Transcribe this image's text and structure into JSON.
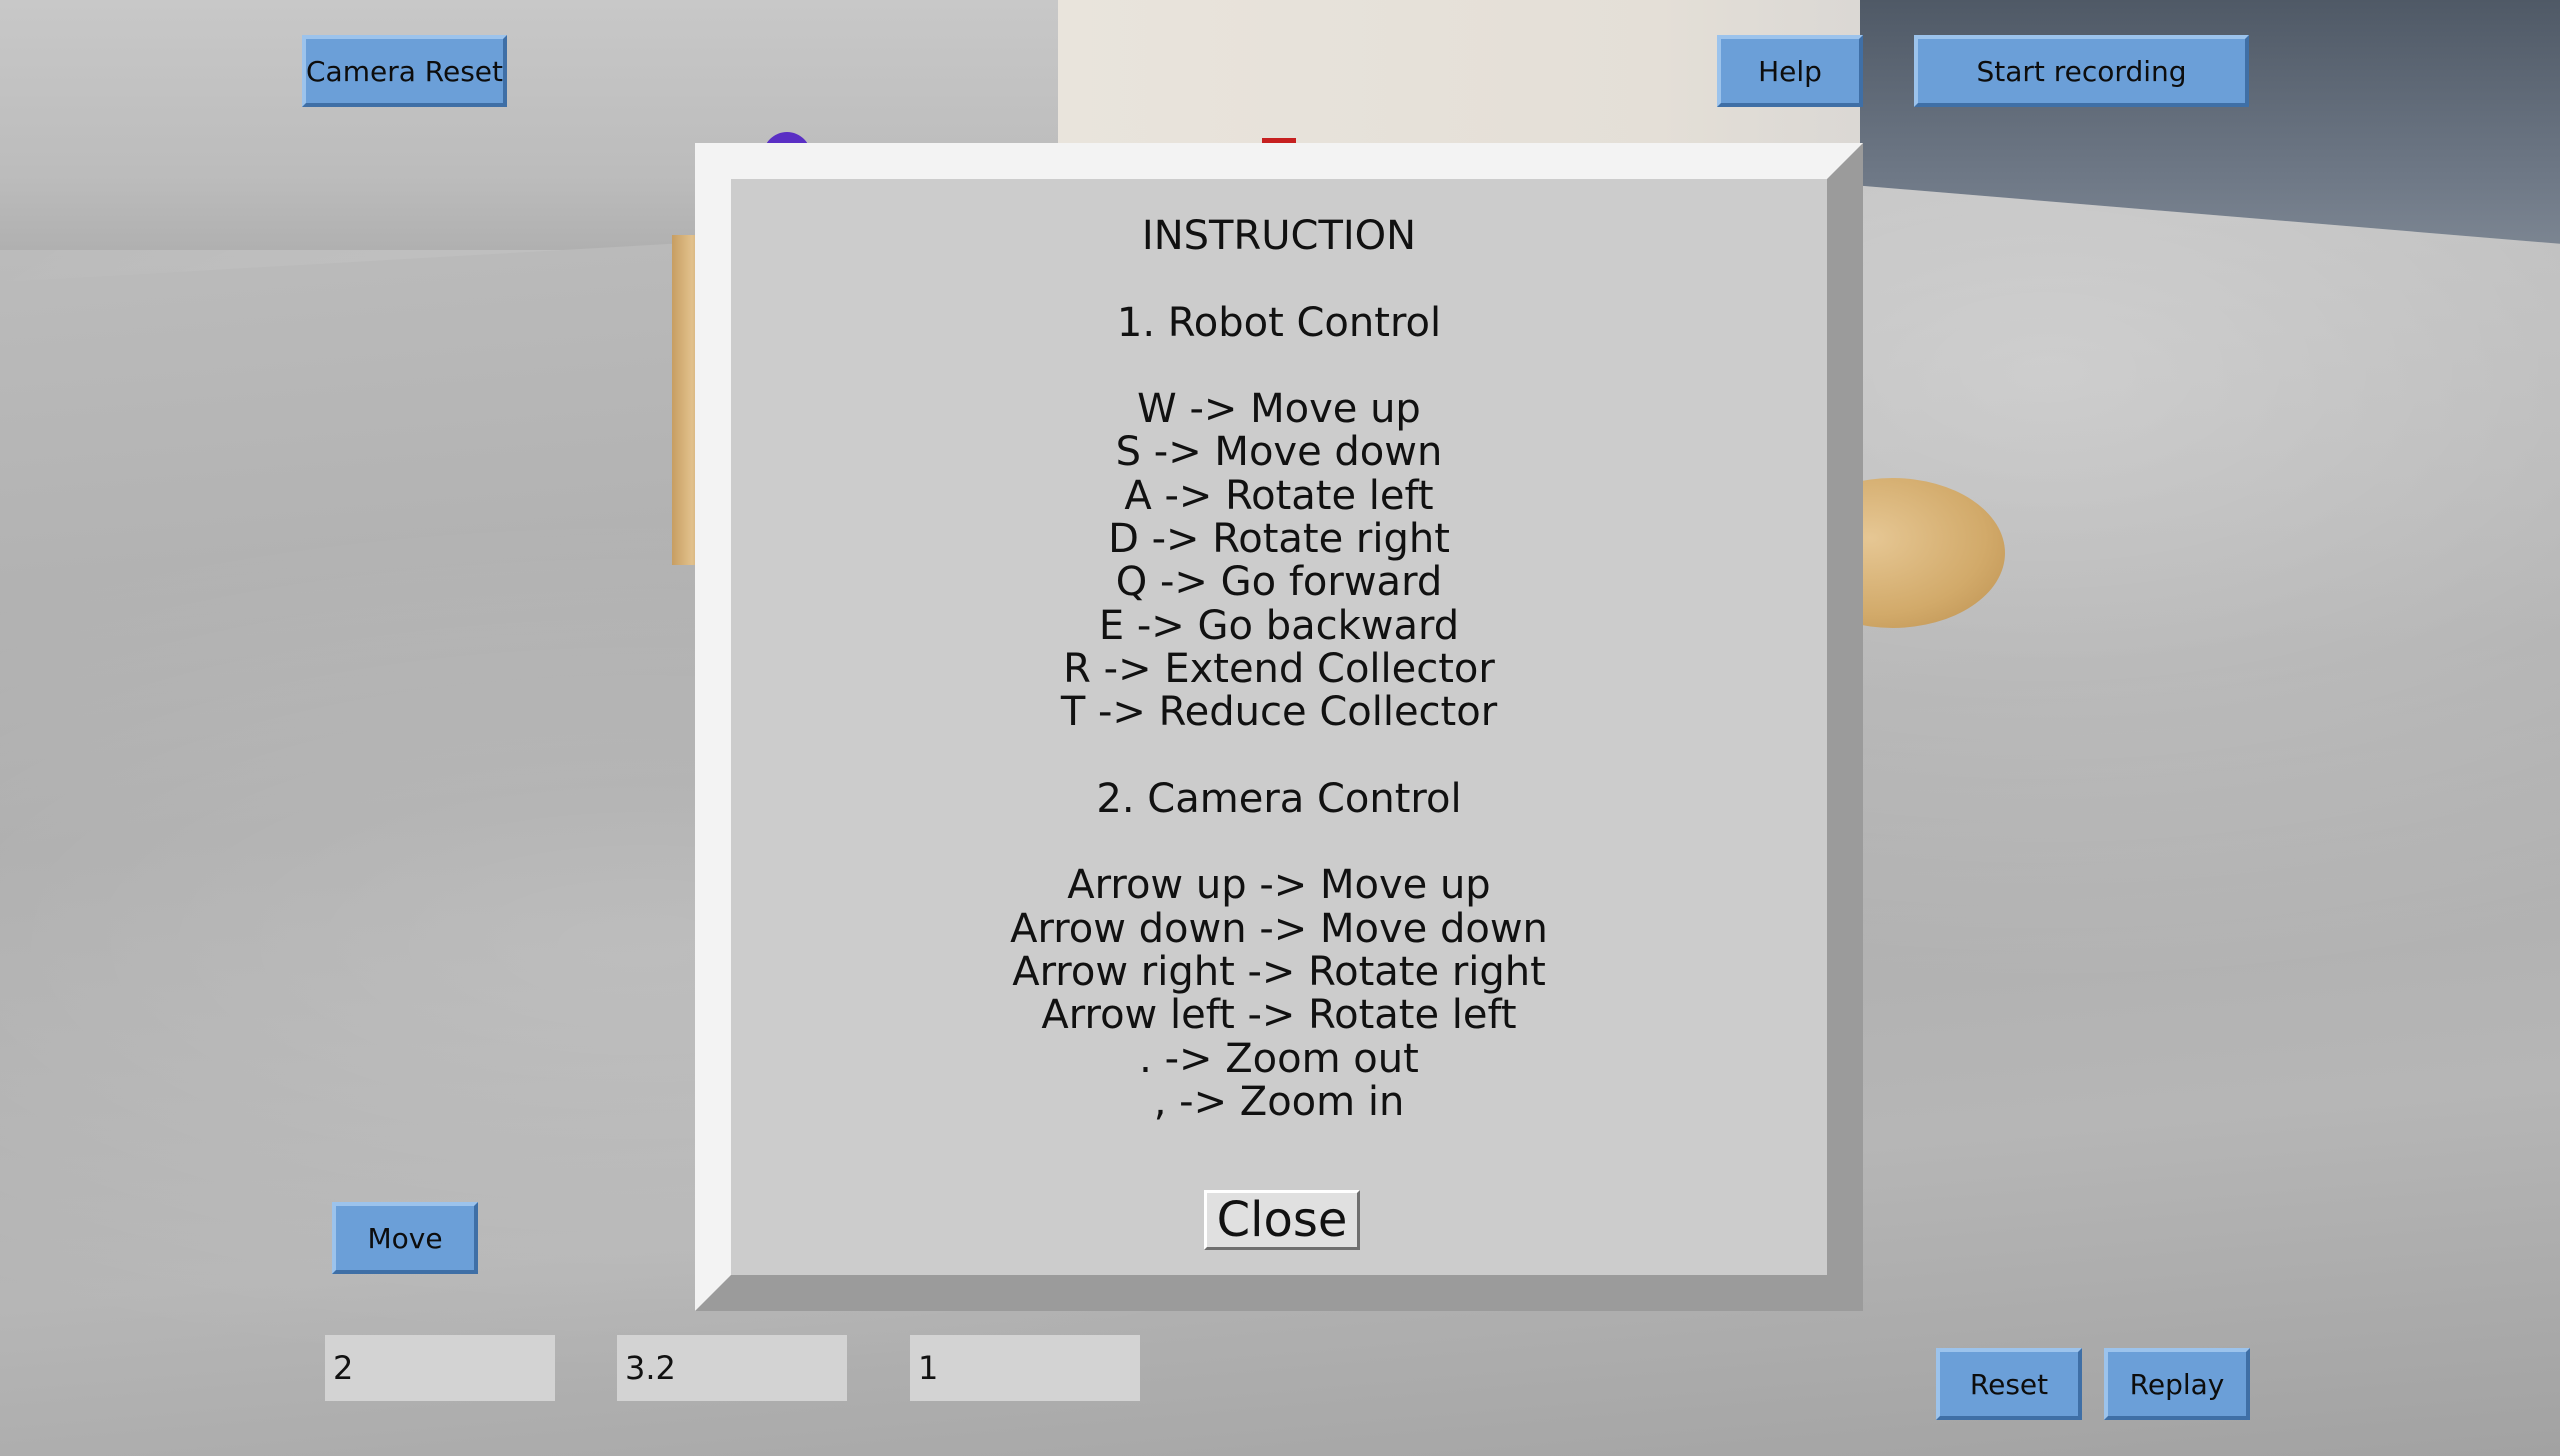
{
  "toolbar": {
    "camera_reset_label": "Camera Reset",
    "help_label": "Help",
    "start_recording_label": "Start recording"
  },
  "controls": {
    "move_label": "Move",
    "inputs": [
      {
        "value": "2"
      },
      {
        "value": "3.2"
      },
      {
        "value": "1"
      }
    ],
    "reset_label": "Reset",
    "replay_label": "Replay"
  },
  "instruction_dialog": {
    "title": "INSTRUCTION",
    "robot_section_heading": "1. Robot Control",
    "robot_controls": [
      "W -> Move up",
      "S -> Move down",
      "A -> Rotate left",
      "D -> Rotate right",
      "Q -> Go forward",
      "E -> Go backward",
      "R -> Extend Collector",
      "T -> Reduce Collector"
    ],
    "camera_section_heading": "2. Camera Control",
    "camera_controls": [
      "Arrow up -> Move up",
      "Arrow down -> Move down",
      "Arrow right -> Rotate right",
      "Arrow left -> Rotate left",
      ". -> Zoom out",
      ", -> Zoom in"
    ],
    "close_label": "Close"
  },
  "colors": {
    "button_blue": "#6b9fd8",
    "dialog_gray": "#cccccc",
    "input_gray": "#d3d3d3"
  }
}
